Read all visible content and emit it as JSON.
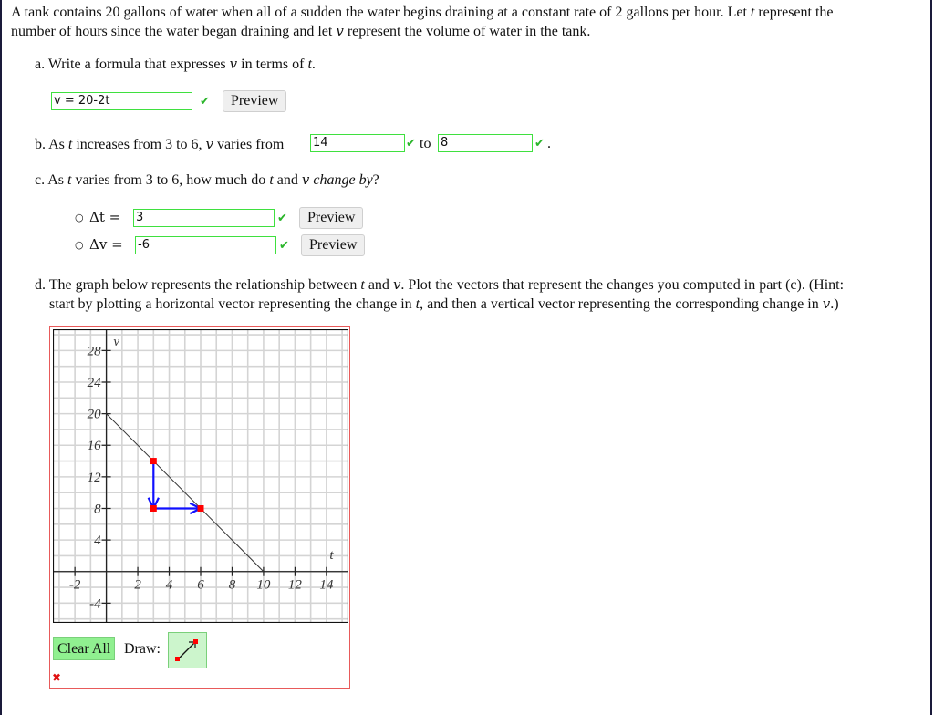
{
  "problem": {
    "intro_line1_a": "A tank contains 20 gallons of water when all of a sudden the water begins draining at a constant rate of 2 gallons per hour. Let ",
    "intro_var_t": "t",
    "intro_line1_b": " represent the",
    "intro_line2_a": "number of hours since the water began draining and let ",
    "intro_var_v": "v",
    "intro_line2_b": " represent the volume of water in the tank."
  },
  "part_a": {
    "prefix": "a. Write a formula that expresses ",
    "var_v": "v",
    "middle": " in terms of ",
    "var_t": "t",
    "suffix": ".",
    "answer_value": "v = 20-2t",
    "status": "correct",
    "check_icon": "✔",
    "preview_label": "Preview"
  },
  "part_b": {
    "prefix": "b. As ",
    "var_t": "t",
    "mid1": " increases from 3 to 6, ",
    "var_v": "v",
    "mid2": " varies from",
    "answer1_value": "14",
    "to_label": "to",
    "answer2_value": "8",
    "suffix": ".",
    "check_icon": "✔"
  },
  "part_c": {
    "prefix": "c. As ",
    "var_t": "t",
    "mid1": " varies from 3 to 6, how much do ",
    "var_t2": "t",
    "mid2": " and ",
    "var_v": "v",
    "italic_phrase": "change by",
    "suffix": "?",
    "items": [
      {
        "bullet": "○",
        "label": "Δt =",
        "value": "3",
        "check_icon": "✔",
        "preview_label": "Preview"
      },
      {
        "bullet": "○",
        "label": "Δv =",
        "value": "-6",
        "check_icon": "✔",
        "preview_label": "Preview"
      }
    ]
  },
  "part_d": {
    "line1_a": "d. The graph below represents the relationship between ",
    "var_t": "t",
    "line1_b": " and ",
    "var_v": "v",
    "line1_c": ". Plot the vectors that represent the changes you computed in part (c). (Hint:",
    "line2_a": "start by plotting a horizontal vector representing the change in ",
    "var_t2": "t",
    "line2_b": ", and then a vertical vector representing the corresponding change in ",
    "var_v2": "v",
    "line2_c": ".)"
  },
  "graph_tools": {
    "clear_label": "Clear All",
    "draw_label": "Draw:",
    "draw_tool_icon": "vector-arrow",
    "error_icon": "✖"
  },
  "chart_data": {
    "type": "line",
    "xlabel": "t",
    "ylabel": "v",
    "xlim": [
      -3.4,
      15.4
    ],
    "ylim": [
      -6.5,
      30.7
    ],
    "grid": true,
    "x_grid_step": 1,
    "y_grid_step": 2,
    "x_ticks": [
      -2,
      2,
      4,
      6,
      8,
      10,
      12,
      14
    ],
    "y_ticks": [
      -4,
      4,
      8,
      12,
      16,
      20,
      24,
      28
    ],
    "series": [
      {
        "name": "v = 20 - 2t",
        "points": [
          [
            0,
            20
          ],
          [
            10,
            0
          ]
        ],
        "color": "#333333"
      }
    ],
    "vectors": [
      {
        "name": "delta-v",
        "from": [
          3,
          14
        ],
        "to": [
          3,
          8
        ],
        "color": "#1010ff"
      },
      {
        "name": "delta-t",
        "from": [
          3,
          8
        ],
        "to": [
          6,
          8
        ],
        "color": "#1010ff"
      }
    ],
    "points": [
      {
        "x": 3,
        "y": 14,
        "color": "#ff0000"
      },
      {
        "x": 3,
        "y": 8,
        "color": "#ff0000"
      },
      {
        "x": 6,
        "y": 8,
        "color": "#ff0000"
      }
    ]
  },
  "colors": {
    "correct": "#2bb52b",
    "input_border": "#3fe03f",
    "graph_border_error": "#e85a5a",
    "vector": "#1010ff",
    "point": "#ff0000"
  }
}
